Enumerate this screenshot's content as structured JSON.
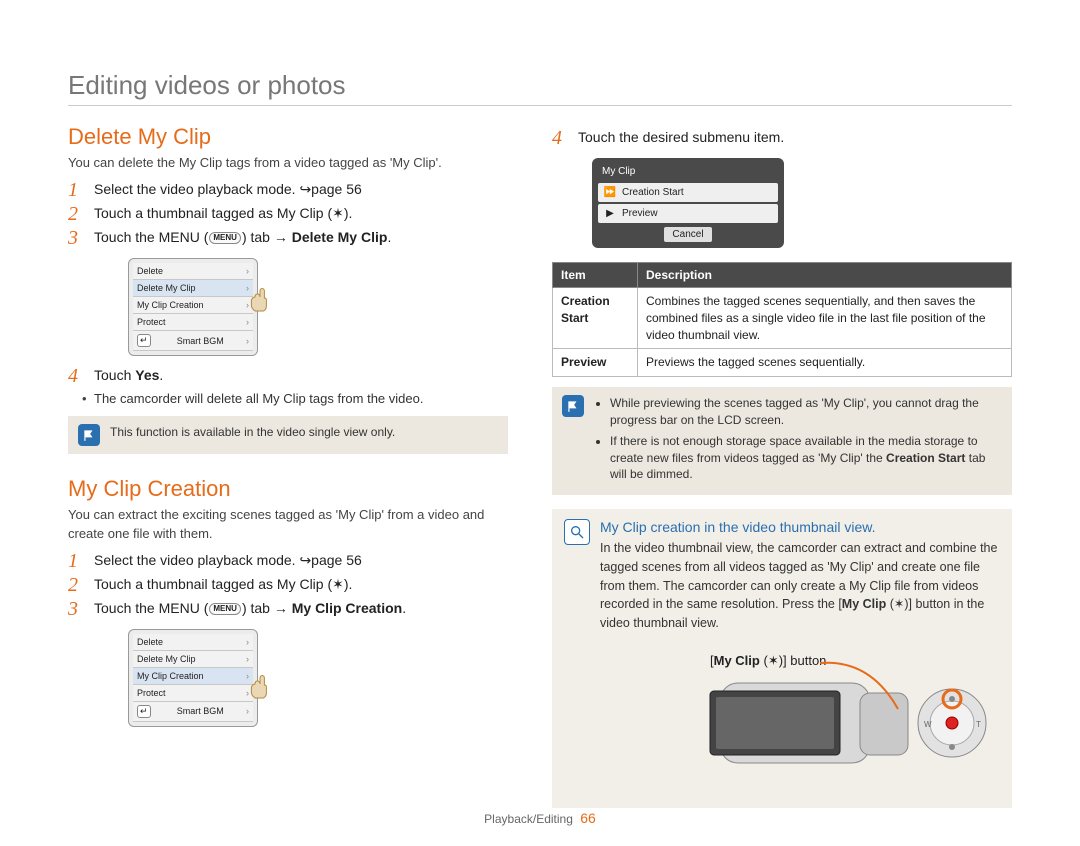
{
  "page_title": "Editing videos or photos",
  "footer": {
    "section": "Playback/Editing",
    "page": "66"
  },
  "section_a": {
    "title": "Delete My Clip",
    "lead": "You can delete the My Clip tags from a video tagged as 'My Clip'.",
    "steps": {
      "s1": "Select the video playback mode. ↪page 56",
      "s2_pre": "Touch a thumbnail tagged as My Clip (",
      "s2_post": ").",
      "s3_pre": "Touch the MENU (",
      "s3_mid": ") tab → ",
      "s3_bold": "Delete My Clip",
      "s3_post": ".",
      "s4_pre": "Touch ",
      "s4_bold": "Yes",
      "s4_post": "."
    },
    "substep": "The camcorder will delete all My Clip tags from the video.",
    "note": "This function is available in the video single view only.",
    "menu_items": [
      "Delete",
      "Delete My Clip",
      "My Clip Creation",
      "Protect",
      "Smart BGM"
    ],
    "menu_highlight_index": 1
  },
  "section_b": {
    "title": "My Clip Creation",
    "lead": "You can extract the exciting scenes tagged as 'My Clip' from a video and create one file with them.",
    "steps": {
      "s1": "Select the video playback mode. ↪page 56",
      "s2_pre": "Touch a thumbnail tagged as My Clip (",
      "s2_post": ").",
      "s3_pre": "Touch the MENU (",
      "s3_mid": ") tab → ",
      "s3_bold": "My Clip Creation",
      "s3_post": "."
    },
    "menu_items": [
      "Delete",
      "Delete My Clip",
      "My Clip Creation",
      "Protect",
      "Smart BGM"
    ],
    "menu_highlight_index": 2
  },
  "right": {
    "step4": "Touch the desired submenu item.",
    "submenu": {
      "title": "My Clip",
      "rows": [
        "Creation Start",
        "Preview"
      ],
      "cancel": "Cancel"
    },
    "table": {
      "headers": [
        "Item",
        "Description"
      ],
      "rows": [
        {
          "item": "Creation Start",
          "desc": "Combines the tagged scenes sequentially, and then saves the combined files as a single video file in the last file position of the video thumbnail view."
        },
        {
          "item": "Preview",
          "desc": "Previews the tagged scenes sequentially."
        }
      ]
    },
    "note_list": [
      "While previewing the scenes tagged as 'My Clip', you cannot drag the progress bar on the LCD screen.",
      "If there is not enough storage space available in the media storage to create new files from videos tagged as 'My Clip' the Creation Start tab will be dimmed."
    ],
    "q": {
      "title": "My Clip creation in the video thumbnail view.",
      "body_pre": "In the video thumbnail view, the camcorder can extract and combine the tagged scenes from all videos tagged as 'My Clip' and create one file from them. The camcorder can only create a My Clip file from videos recorded in the same resolution. Press the [",
      "body_btn": "My Clip",
      "body_mid": " (",
      "body_post": ")] button in the video thumbnail view.",
      "caption_pre": "[",
      "caption_btn": "My Clip",
      "caption_mid": " (",
      "caption_post": ")] button"
    }
  },
  "icons": {
    "menu_badge": "MENU",
    "back": "↵",
    "chevron": "›"
  },
  "colors": {
    "accent": "#e66b1a",
    "link_blue": "#2a6fb0"
  }
}
